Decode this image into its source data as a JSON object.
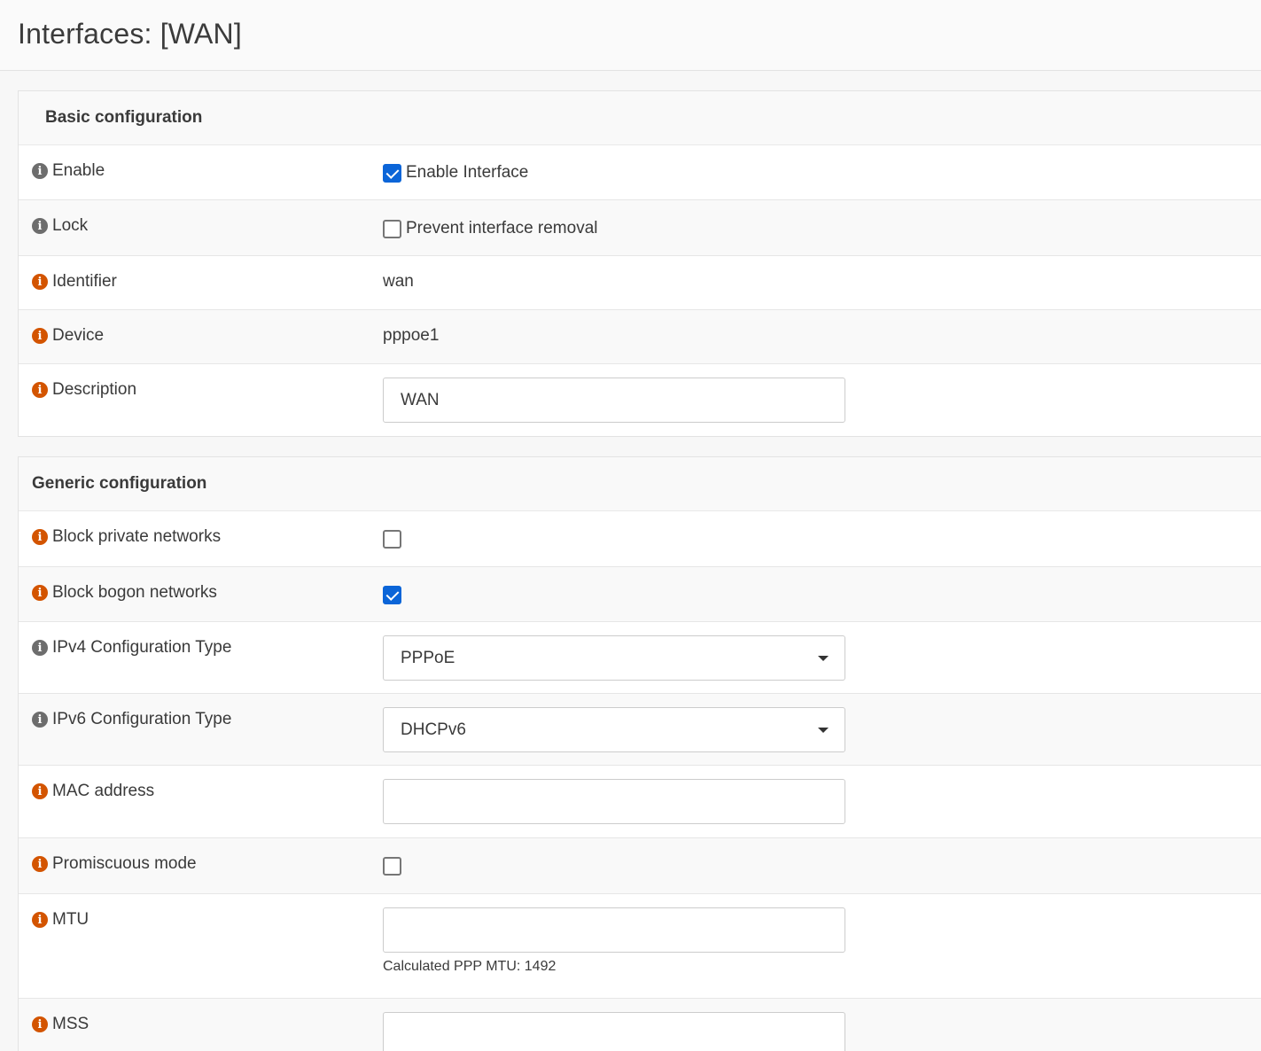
{
  "page": {
    "title": "Interfaces: [WAN]"
  },
  "basic": {
    "title": "Basic configuration",
    "enable": {
      "label": "Enable",
      "checkbox_label": "Enable Interface",
      "checked": true
    },
    "lock": {
      "label": "Lock",
      "checkbox_label": "Prevent interface removal",
      "checked": false
    },
    "identifier": {
      "label": "Identifier",
      "value": "wan"
    },
    "device": {
      "label": "Device",
      "value": "pppoe1"
    },
    "description": {
      "label": "Description",
      "value": "WAN"
    }
  },
  "generic": {
    "title": "Generic configuration",
    "block_private": {
      "label": "Block private networks",
      "checked": false
    },
    "block_bogon": {
      "label": "Block bogon networks",
      "checked": true
    },
    "ipv4_type": {
      "label": "IPv4 Configuration Type",
      "value": "PPPoE"
    },
    "ipv6_type": {
      "label": "IPv6 Configuration Type",
      "value": "DHCPv6"
    },
    "mac": {
      "label": "MAC address",
      "value": ""
    },
    "promisc": {
      "label": "Promiscuous mode",
      "checked": false
    },
    "mtu": {
      "label": "MTU",
      "value": "",
      "hint": "Calculated PPP MTU: 1492"
    },
    "mss": {
      "label": "MSS",
      "value": ""
    }
  },
  "colors": {
    "accent": "#0b65d8",
    "info_orange": "#d35400",
    "info_grey": "#6d6d6d"
  },
  "icons": {
    "info": "info-circle-icon",
    "dropdown": "caret-down-icon"
  }
}
